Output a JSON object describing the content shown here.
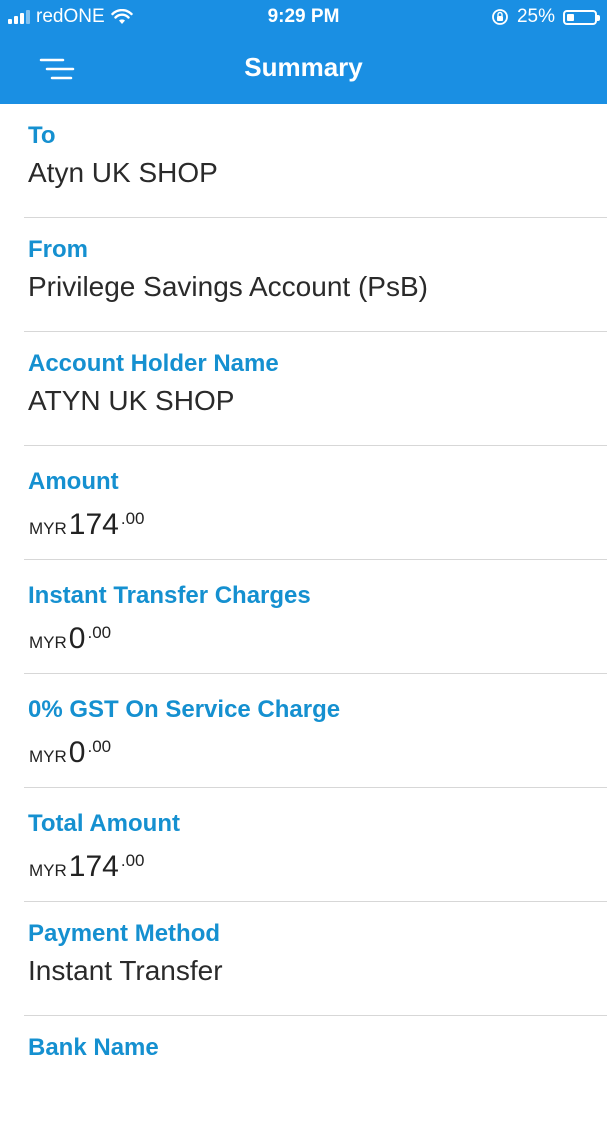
{
  "status": {
    "carrier": "redONE",
    "time": "9:29 PM",
    "battery": "25%",
    "battery_level": 0.25
  },
  "header": {
    "title": "Summary",
    "menu_icon": "menu-icon"
  },
  "fields": [
    {
      "label": "To",
      "value": "Atyn UK SHOP"
    },
    {
      "label": "From",
      "value": "Privilege Savings Account (PsB)"
    },
    {
      "label": "Account Holder Name",
      "value": "ATYN UK SHOP"
    },
    {
      "label": "Amount",
      "currency": "MYR",
      "integer": "174",
      "decimal": ".00"
    },
    {
      "label": "Instant Transfer Charges",
      "currency": "MYR",
      "integer": "0",
      "decimal": ".00"
    },
    {
      "label": "0% GST On Service Charge",
      "currency": "MYR",
      "integer": "0",
      "decimal": ".00"
    },
    {
      "label": "Total Amount",
      "currency": "MYR",
      "integer": "174",
      "decimal": ".00"
    },
    {
      "label": "Payment Method",
      "value": "Instant Transfer"
    },
    {
      "label": "Bank Name"
    }
  ],
  "colors": {
    "header_bg": "#1a8fe3",
    "label": "#1590d0"
  }
}
